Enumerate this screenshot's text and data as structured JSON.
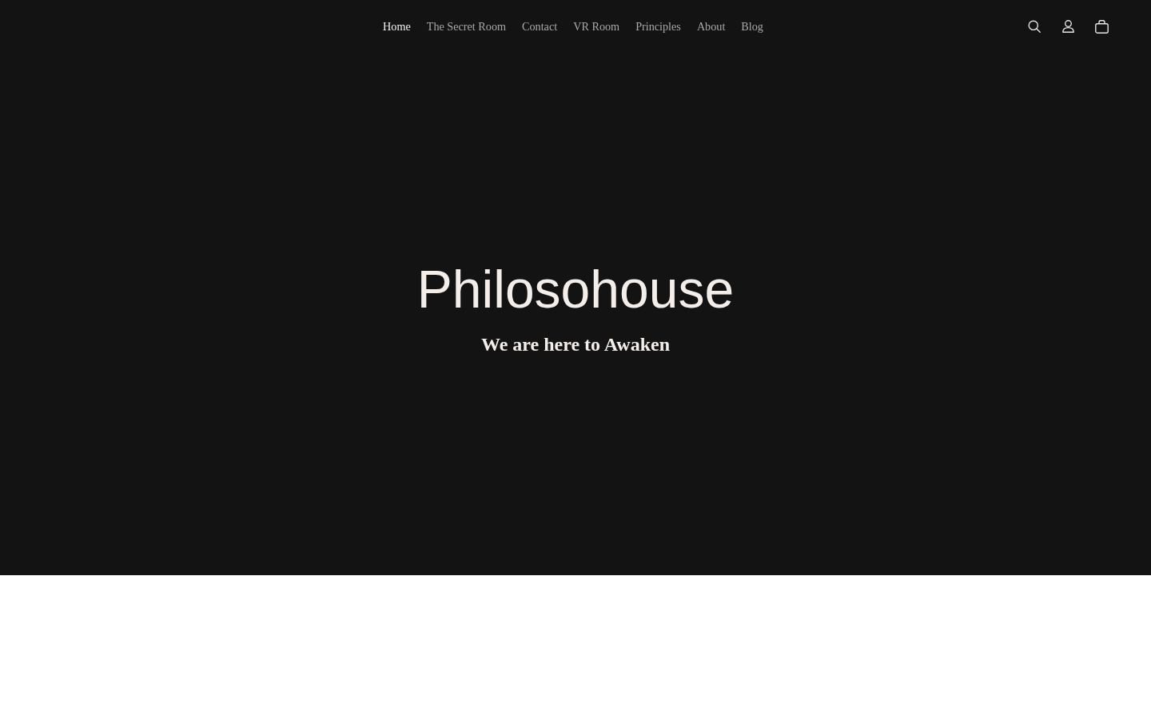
{
  "header": {
    "nav": [
      {
        "label": "Home",
        "selected": true
      },
      {
        "label": "The Secret Room",
        "selected": false
      },
      {
        "label": "Contact",
        "selected": false
      },
      {
        "label": "VR Room",
        "selected": false
      },
      {
        "label": "Principles",
        "selected": false
      },
      {
        "label": "About",
        "selected": false
      },
      {
        "label": "Blog",
        "selected": false
      }
    ],
    "actions": [
      {
        "kind": "search"
      },
      {
        "kind": "account"
      },
      {
        "kind": "cart"
      }
    ]
  },
  "hero": {
    "title": "Philosohouse",
    "subtitle": "We are here to Awaken"
  }
}
